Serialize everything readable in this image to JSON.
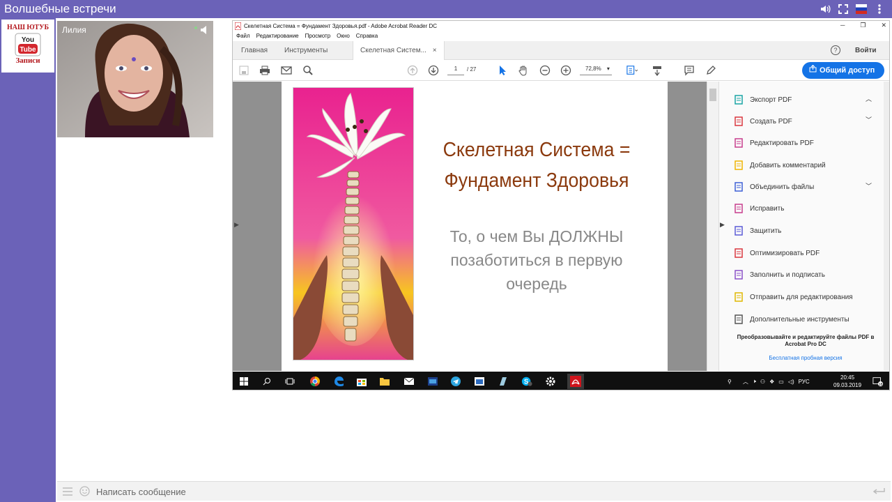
{
  "app": {
    "title": "Волшебные встречи"
  },
  "youtube_box": {
    "top_text": "НАШ ЮТУБ",
    "logo_you": "You",
    "logo_tube": "Tube",
    "bottom_text": "Записи"
  },
  "video": {
    "name": "Лилия"
  },
  "acrobat": {
    "window_title": "Скелетная Система = Фундамент Здоровья.pdf - Adobe Acrobat Reader DC",
    "menu": [
      "Файл",
      "Редактирование",
      "Просмотр",
      "Окно",
      "Справка"
    ],
    "tabs": {
      "home": "Главная",
      "tools": "Инструменты",
      "doc": "Скелетная Систем...",
      "doc_close": "×"
    },
    "signin": "Войти",
    "page_current": "1",
    "page_total": "/ 27",
    "zoom": "72,8%",
    "share_label": "Общий доступ",
    "doc_title": "Скелетная Система = Фундамент Здоровья",
    "doc_subtitle": "То, о чем Вы ДОЛЖНЫ позаботиться в первую очередь",
    "tools": [
      {
        "label": "Экспорт PDF",
        "icon": "export-pdf-icon",
        "color": "#19a4a4"
      },
      {
        "label": "Создать PDF",
        "icon": "create-pdf-icon",
        "color": "#d9363e"
      },
      {
        "label": "Редактировать PDF",
        "icon": "edit-pdf-icon",
        "color": "#c83c8c"
      },
      {
        "label": "Добавить комментарий",
        "icon": "comment-icon",
        "color": "#f0b400"
      },
      {
        "label": "Объединить файлы",
        "icon": "combine-files-icon",
        "color": "#3c5fd6"
      },
      {
        "label": "Исправить",
        "icon": "fix-icon",
        "color": "#c83c8c"
      },
      {
        "label": "Защитить",
        "icon": "protect-icon",
        "color": "#5b5bd6"
      },
      {
        "label": "Оптимизировать PDF",
        "icon": "optimize-pdf-icon",
        "color": "#d9363e"
      },
      {
        "label": "Заполнить и подписать",
        "icon": "fill-sign-icon",
        "color": "#8a4fc8"
      },
      {
        "label": "Отправить для редактирования",
        "icon": "send-review-icon",
        "color": "#e0b800"
      },
      {
        "label": "Дополнительные инструменты",
        "icon": "more-tools-icon",
        "color": "#555555"
      }
    ],
    "promo": "Преобразовывайте и редактируйте файлы PDF в Acrobat Pro DC",
    "trial": "Бесплатная пробная версия"
  },
  "taskbar": {
    "lang": "РУС",
    "time": "20:45",
    "date": "09.03.2019",
    "notif_count": "18"
  },
  "chat": {
    "placeholder": "Написать сообщение"
  },
  "colors": {
    "brand": "#6b62b8",
    "acrobat_blue": "#1473e6",
    "title_brown": "#8b3a0e"
  }
}
